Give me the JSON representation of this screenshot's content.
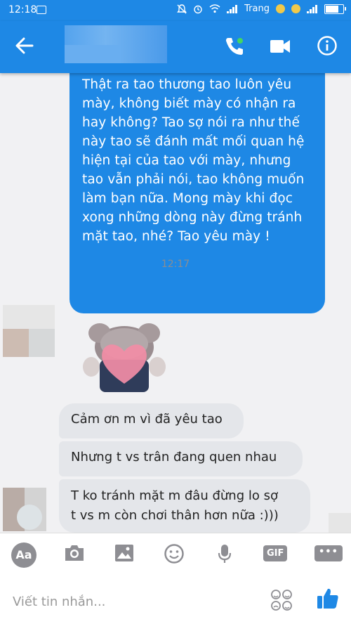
{
  "status": {
    "time": "12:18",
    "carrier": "Trang",
    "signal": ".ıll"
  },
  "header": {
    "back_icon": "arrow-left-icon",
    "call_icon": "phone-icon",
    "video_icon": "video-camera-icon",
    "info_icon": "info-icon"
  },
  "messages": {
    "outgoing": {
      "lines": [
        "Thật ra tao thương tao luôn yêu",
        "mày, không biết mày có nhận ra",
        "hay không? Tao sợ nói ra như thế",
        "này tao sẽ đánh mất mối quan hệ",
        "hiện tại của tao với mày, nhưng",
        "tao vẫn phải nói, tao không muốn",
        "làm bạn nữa. Mong mày khi đọc",
        "xong những dòng này đừng tránh",
        "mặt tao, nhé? Tao yêu mày !"
      ]
    },
    "timestamp": "12:17",
    "incoming": [
      {
        "text": "Cảm ơn m vì đã yêu tao"
      },
      {
        "text": "Nhưng t vs trân đang quen nhau"
      },
      {
        "line1": "T ko tránh mặt m đâu đừng lo sợ",
        "line2": "t vs m còn chơi thân hơn nữa :)))"
      }
    ]
  },
  "toolbar": {
    "aa_label": "Aa",
    "gif_label": "GIF",
    "more_label": "•••"
  },
  "composer": {
    "placeholder": "Viết tin nhắn..."
  },
  "colors": {
    "brand": "#1e88e5",
    "incoming_bubble": "#e4e6ea",
    "like": "#1e88e5"
  }
}
